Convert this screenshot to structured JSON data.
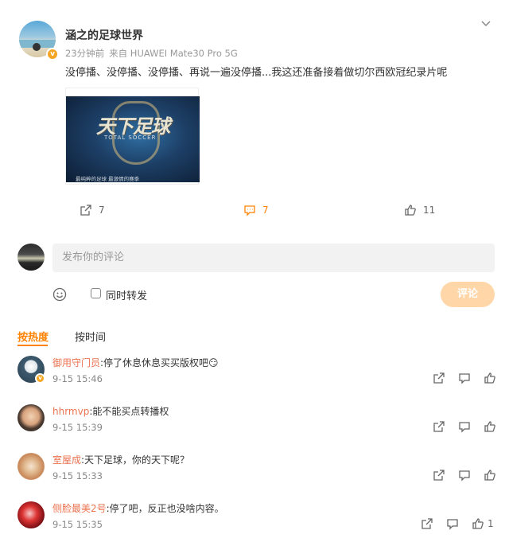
{
  "post": {
    "username": "涵之的足球世界",
    "time": "23分钟前",
    "source": "来自 HUAWEI Mate30 Pro 5G",
    "text": "没停播、没停播、没停播、再说一遍没停播...我这还准备接着做切尔西欧冠纪录片呢",
    "image": {
      "logo_text": "天下足球",
      "logo_sub": "TOTAL SOCCER",
      "caption": "最纯粹的足球  最激情的赛季"
    },
    "actions": {
      "repost_count": "7",
      "comment_count": "7",
      "like_count": "11"
    }
  },
  "comment_box": {
    "placeholder": "发布你的评论",
    "repost_label": "同时转发",
    "submit_label": "评论"
  },
  "sort": {
    "hot": "按热度",
    "time": "按时间"
  },
  "comments": [
    {
      "name": "御用守门员",
      "text": ":停了休息休息买买版权吧😏",
      "time": "9-15 15:46",
      "verified": true
    },
    {
      "name": "hhrmvp",
      "text": ":能不能买点转播权",
      "time": "9-15 15:39",
      "verified": false
    },
    {
      "name": "室屋成",
      "text": ":天下足球，你的天下呢？",
      "time": "9-15 15:33",
      "verified": false
    },
    {
      "name": "侧脸最美2号",
      "text": ":停了吧，反正也没啥内容。",
      "time": "9-15 15:35",
      "verified": false,
      "like_count": "1"
    }
  ],
  "colors": {
    "accent": "#ff8200",
    "username_link": "#eb7350",
    "submit_disabled": "#ffd6a8",
    "verified_badge": "#f5a623"
  }
}
